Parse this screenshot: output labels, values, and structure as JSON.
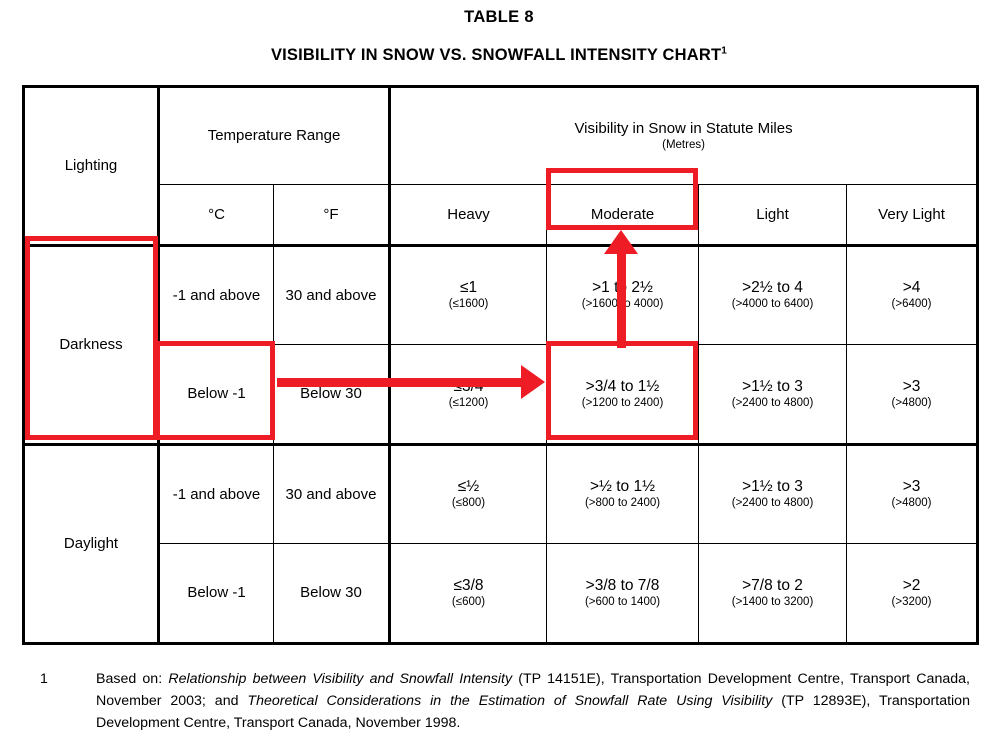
{
  "document": {
    "table_number": "TABLE 8",
    "title": "VISIBILITY IN SNOW VS. SNOWFALL INTENSITY CHART",
    "title_footnote_marker": "1"
  },
  "table": {
    "headers": {
      "lighting": "Lighting",
      "temperature_range": "Temperature Range",
      "celsius": "°C",
      "fahrenheit": "°F",
      "visibility_group": "Visibility in Snow in Statute Miles",
      "visibility_group_units": "(Metres)",
      "intensity": [
        "Heavy",
        "Moderate",
        "Light",
        "Very Light"
      ]
    },
    "row_groups": [
      {
        "lighting": "Darkness",
        "rows": [
          {
            "celsius": "-1 and above",
            "fahrenheit": "30 and above",
            "cells": [
              {
                "miles": "≤1",
                "metres": "(≤1600)"
              },
              {
                "miles": ">1 to 2½",
                "metres": "(>1600 to 4000)"
              },
              {
                "miles": ">2½ to 4",
                "metres": "(>4000 to 6400)"
              },
              {
                "miles": ">4",
                "metres": "(>6400)"
              }
            ]
          },
          {
            "celsius": "Below -1",
            "fahrenheit": "Below 30",
            "cells": [
              {
                "miles": "≤3/4",
                "metres": "(≤1200)"
              },
              {
                "miles": ">3/4 to 1½",
                "metres": "(>1200 to 2400)"
              },
              {
                "miles": ">1½ to 3",
                "metres": "(>2400 to 4800)"
              },
              {
                "miles": ">3",
                "metres": "(>4800)"
              }
            ]
          }
        ]
      },
      {
        "lighting": "Daylight",
        "rows": [
          {
            "celsius": "-1 and above",
            "fahrenheit": "30 and above",
            "cells": [
              {
                "miles": "≤½",
                "metres": "(≤800)"
              },
              {
                "miles": ">½ to 1½",
                "metres": "(>800 to 2400)"
              },
              {
                "miles": ">1½ to 3",
                "metres": "(>2400 to 4800)"
              },
              {
                "miles": ">3",
                "metres": "(>4800)"
              }
            ]
          },
          {
            "celsius": "Below -1",
            "fahrenheit": "Below 30",
            "cells": [
              {
                "miles": "≤3/8",
                "metres": "(≤600)"
              },
              {
                "miles": ">3/8 to 7/8",
                "metres": "(>600 to 1400)"
              },
              {
                "miles": ">7/8 to 2",
                "metres": "(>1400 to 3200)"
              },
              {
                "miles": ">2",
                "metres": "(>3200)"
              }
            ]
          }
        ]
      }
    ]
  },
  "annotations": {
    "color": "#ee1c25",
    "highlights": [
      "Darkness lighting cell",
      "Below -1 temperature cell",
      "Moderate intensity column header",
      ">3/4 to 1½ (>1200 to 2400) result cell"
    ]
  },
  "footnote": {
    "number": "1",
    "lead": "Based on:",
    "ref1_title": "Relationship between Visibility and Snowfall Intensity",
    "ref1_rest": "(TP 14151E), Transportation Development Centre, Transport Canada, November 2003; and",
    "ref2_title": "Theoretical Considerations in the Estimation of Snowfall Rate Using Visibility",
    "ref2_rest": "(TP 12893E), Transportation Development Centre, Transport Canada, November 1998."
  },
  "chart_data": {
    "type": "table",
    "title": "VISIBILITY IN SNOW VS. SNOWFALL INTENSITY CHART",
    "columns": [
      "Lighting",
      "°C",
      "°F",
      "Heavy",
      "Moderate",
      "Light",
      "Very Light"
    ],
    "rows": [
      [
        "Darkness",
        "-1 and above",
        "30 and above",
        "≤1 (≤1600)",
        ">1 to 2½ (>1600 to 4000)",
        ">2½ to 4 (>4000 to 6400)",
        ">4 (>6400)"
      ],
      [
        "Darkness",
        "Below -1",
        "Below 30",
        "≤3/4 (≤1200)",
        ">3/4 to 1½ (>1200 to 2400)",
        ">1½ to 3 (>2400 to 4800)",
        ">3 (>4800)"
      ],
      [
        "Daylight",
        "-1 and above",
        "30 and above",
        "≤½ (≤800)",
        ">½ to 1½ (>800 to 2400)",
        ">1½ to 3 (>2400 to 4800)",
        ">3 (>4800)"
      ],
      [
        "Daylight",
        "Below -1",
        "Below 30",
        "≤3/8 (≤600)",
        ">3/8 to 7/8 (>600 to 1400)",
        ">7/8 to 2 (>1400 to 3200)",
        ">2 (>3200)"
      ]
    ],
    "units_primary": "statute miles",
    "units_secondary": "metres"
  }
}
